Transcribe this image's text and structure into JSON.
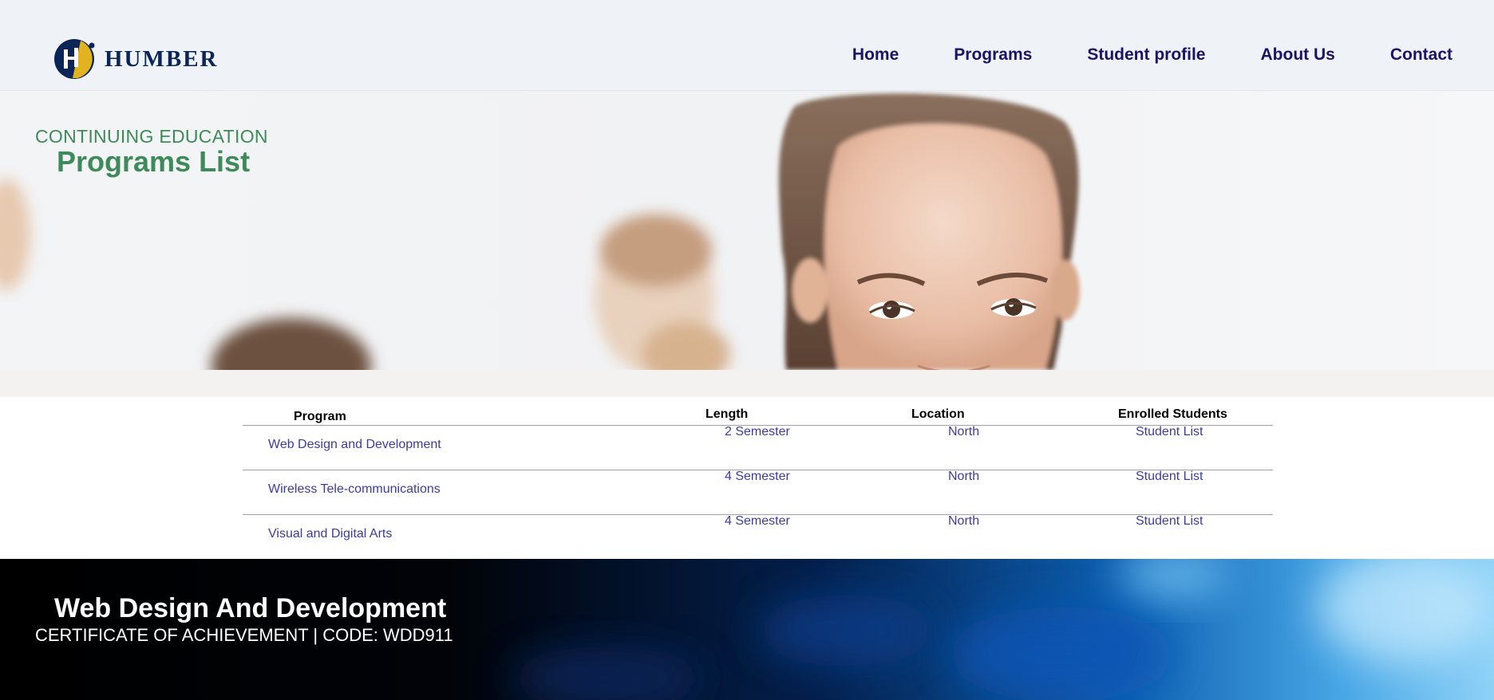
{
  "brand": {
    "name": "HUMBER",
    "colors": {
      "navy": "#0b2557",
      "gold": "#e2b320"
    }
  },
  "nav": {
    "items": [
      {
        "label": "Home"
      },
      {
        "label": "Programs"
      },
      {
        "label": "Student profile"
      },
      {
        "label": "About Us"
      },
      {
        "label": "Contact"
      }
    ],
    "color": "#1a1466"
  },
  "hero": {
    "subtitle": "CONTINUING EDUCATION",
    "title": "Programs List",
    "accent": "#3f8a5a"
  },
  "table": {
    "headers": [
      "Program",
      "Length",
      "Location",
      "Enrolled Students"
    ],
    "rows": [
      {
        "program": "Web Design and Development",
        "length": "2 Semester",
        "location": "North",
        "students": "Student List"
      },
      {
        "program": "Wireless Tele-communications",
        "length": "4 Semester",
        "location": "North",
        "students": "Student List"
      },
      {
        "program": "Visual and Digital Arts",
        "length": "4 Semester",
        "location": "North",
        "students": "Student List"
      }
    ],
    "link_color": "#3c3ca0"
  },
  "banner": {
    "title": "Web Design And Development",
    "subtitle": "CERTIFICATE OF ACHIEVEMENT | CODE: WDD911"
  }
}
